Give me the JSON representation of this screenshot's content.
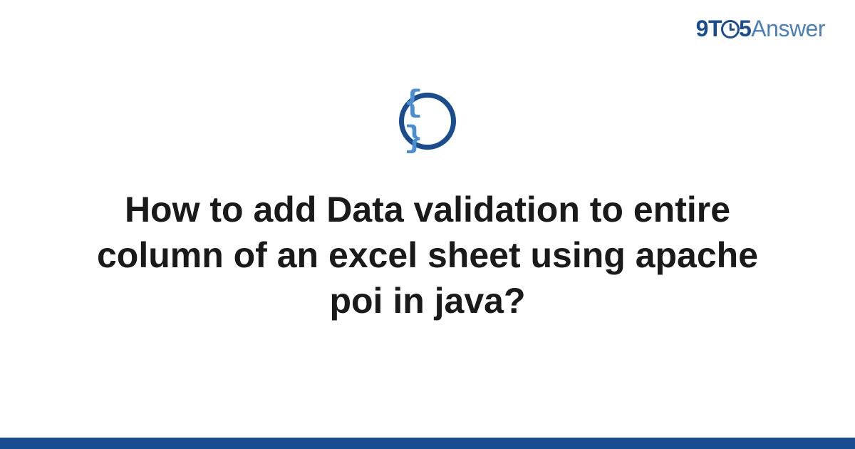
{
  "logo": {
    "part1": "9",
    "part2": "T",
    "part3": "5",
    "part4": "Answer"
  },
  "icon": {
    "braces": "{ }",
    "name": "code-braces-icon"
  },
  "question": {
    "title": "How to add Data validation to entire column of an excel sheet using apache poi in java?"
  },
  "colors": {
    "primary": "#1a4d8f",
    "secondary": "#4a7fb8",
    "accent": "#4a8fd4"
  }
}
